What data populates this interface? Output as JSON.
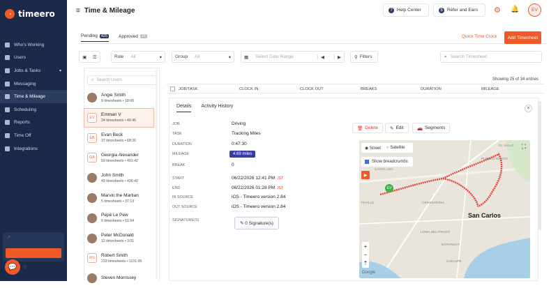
{
  "app": {
    "name": "timeero",
    "page_title": "Time & Mileage"
  },
  "sidebar": {
    "items": [
      {
        "label": "Who's Working",
        "icon": "map-pin-icon",
        "active": false
      },
      {
        "label": "Users",
        "icon": "users-icon",
        "active": false
      },
      {
        "label": "Jobs & Tasks",
        "icon": "briefcase-icon",
        "active": false,
        "has_caret": true
      },
      {
        "label": "Messaging",
        "icon": "message-icon",
        "active": false
      },
      {
        "label": "Time & Mileage",
        "icon": "clock-icon",
        "active": true
      },
      {
        "label": "Scheduling",
        "icon": "calendar-icon",
        "active": false
      },
      {
        "label": "Reports",
        "icon": "chart-icon",
        "active": false
      },
      {
        "label": "Time Off",
        "icon": "plane-icon",
        "active": false
      },
      {
        "label": "Integrations",
        "icon": "plug-icon",
        "active": false
      }
    ]
  },
  "header": {
    "help_label": "Help Center",
    "refer_label": "Refer and Earn",
    "avatar_initials": "EV"
  },
  "tabs": [
    {
      "label": "Pending",
      "count": "425",
      "active": true
    },
    {
      "label": "Approved",
      "count": "37",
      "active": false
    }
  ],
  "actions": {
    "quick_clock": "Quick Time Clock",
    "add_timesheet": "Add Timesheet"
  },
  "filters": {
    "role_label": "Role",
    "role_value": "All",
    "group_label": "Group",
    "group_value": "All",
    "date_placeholder": "Select Date Range",
    "filters_label": "Filters",
    "search_placeholder": "Search Timesheet"
  },
  "showing_text": "Showing 25 of 34 entries",
  "users_search_placeholder": "Search Users",
  "users": [
    {
      "name": "Angie Smith",
      "meta": "9 timesheets  •  18:06",
      "initials": "",
      "photo": true,
      "selected": false
    },
    {
      "name": "Emman V",
      "meta": "34 timesheets  •  49:45",
      "initials": "EV",
      "photo": false,
      "selected": true
    },
    {
      "name": "Evan Beck",
      "meta": "37 timesheets  •  68:26",
      "initials": "EB",
      "photo": false,
      "selected": false
    },
    {
      "name": "Georgia Alexander",
      "meta": "59 timesheets  •  491:42",
      "initials": "GA",
      "photo": false,
      "selected": false
    },
    {
      "name": "John Smith",
      "meta": "49 timesheets  •  436:40",
      "initials": "",
      "photo": true,
      "selected": false
    },
    {
      "name": "Marvin the Martian",
      "meta": "5 timesheets  •  37:13",
      "initials": "",
      "photo": true,
      "selected": false
    },
    {
      "name": "Pepé Le Pew",
      "meta": "6 timesheets  •  51:54",
      "initials": "",
      "photo": true,
      "selected": false
    },
    {
      "name": "Peter McDonald",
      "meta": "12 timesheets  •  3:01",
      "initials": "",
      "photo": true,
      "selected": false
    },
    {
      "name": "Robert Smith",
      "meta": "233 timesheets  •  1101:05",
      "initials": "RS",
      "photo": false,
      "selected": false
    },
    {
      "name": "Steven Morrissey",
      "meta": "",
      "initials": "",
      "photo": true,
      "selected": false
    }
  ],
  "table": {
    "columns": [
      "JOB/TASK",
      "CLOCK IN",
      "CLOCK OUT",
      "BREAKS",
      "DURATION",
      "MILEAGE"
    ]
  },
  "detail": {
    "tabs": [
      "Details",
      "Activity History"
    ],
    "fields": [
      {
        "label": "JOB",
        "value": "Driving"
      },
      {
        "label": "TASK",
        "value": "Tracking Miles"
      },
      {
        "label": "DURATION",
        "value": "0:47:30"
      },
      {
        "label": "MILEAGE",
        "value": "4.69 miles"
      },
      {
        "label": "BREAK",
        "value": "0"
      },
      {
        "label": "START",
        "value": "06/22/2026 12:41 PM",
        "tz": "JST"
      },
      {
        "label": "END",
        "value": "06/22/2026 01:28 PM",
        "tz": "JST"
      },
      {
        "label": "IN SOURCE",
        "value": "iOS - Timeero version 2.84"
      },
      {
        "label": "OUT SOURCE",
        "value": "iOS - Timeero version 2.84"
      },
      {
        "label": "SIGNATURE(S)",
        "value": "0 Signature(s)"
      }
    ],
    "buttons": {
      "delete": "Delete",
      "edit": "Edit",
      "segments": "Segments"
    }
  },
  "map": {
    "street_label": "Street",
    "satellite_label": "Satellite",
    "breadcrumbs_label": "Show breadcrumbs",
    "city_label": "San Carlos",
    "marker_label": "EV",
    "labels": [
      "SANTA ANA",
      "BARANDAY",
      "CHICUPE",
      "CEMENTERIO",
      "LOMA DEL PRADO",
      "EL VALLE",
      "PUEBLO NUEVO",
      "YEVILLE"
    ],
    "google_label": "Google",
    "route_color": "#e2453c"
  },
  "colors": {
    "accent": "#f05a28",
    "sidebar": "#1c2a4a",
    "mileage_badge": "#3a3aa8"
  }
}
